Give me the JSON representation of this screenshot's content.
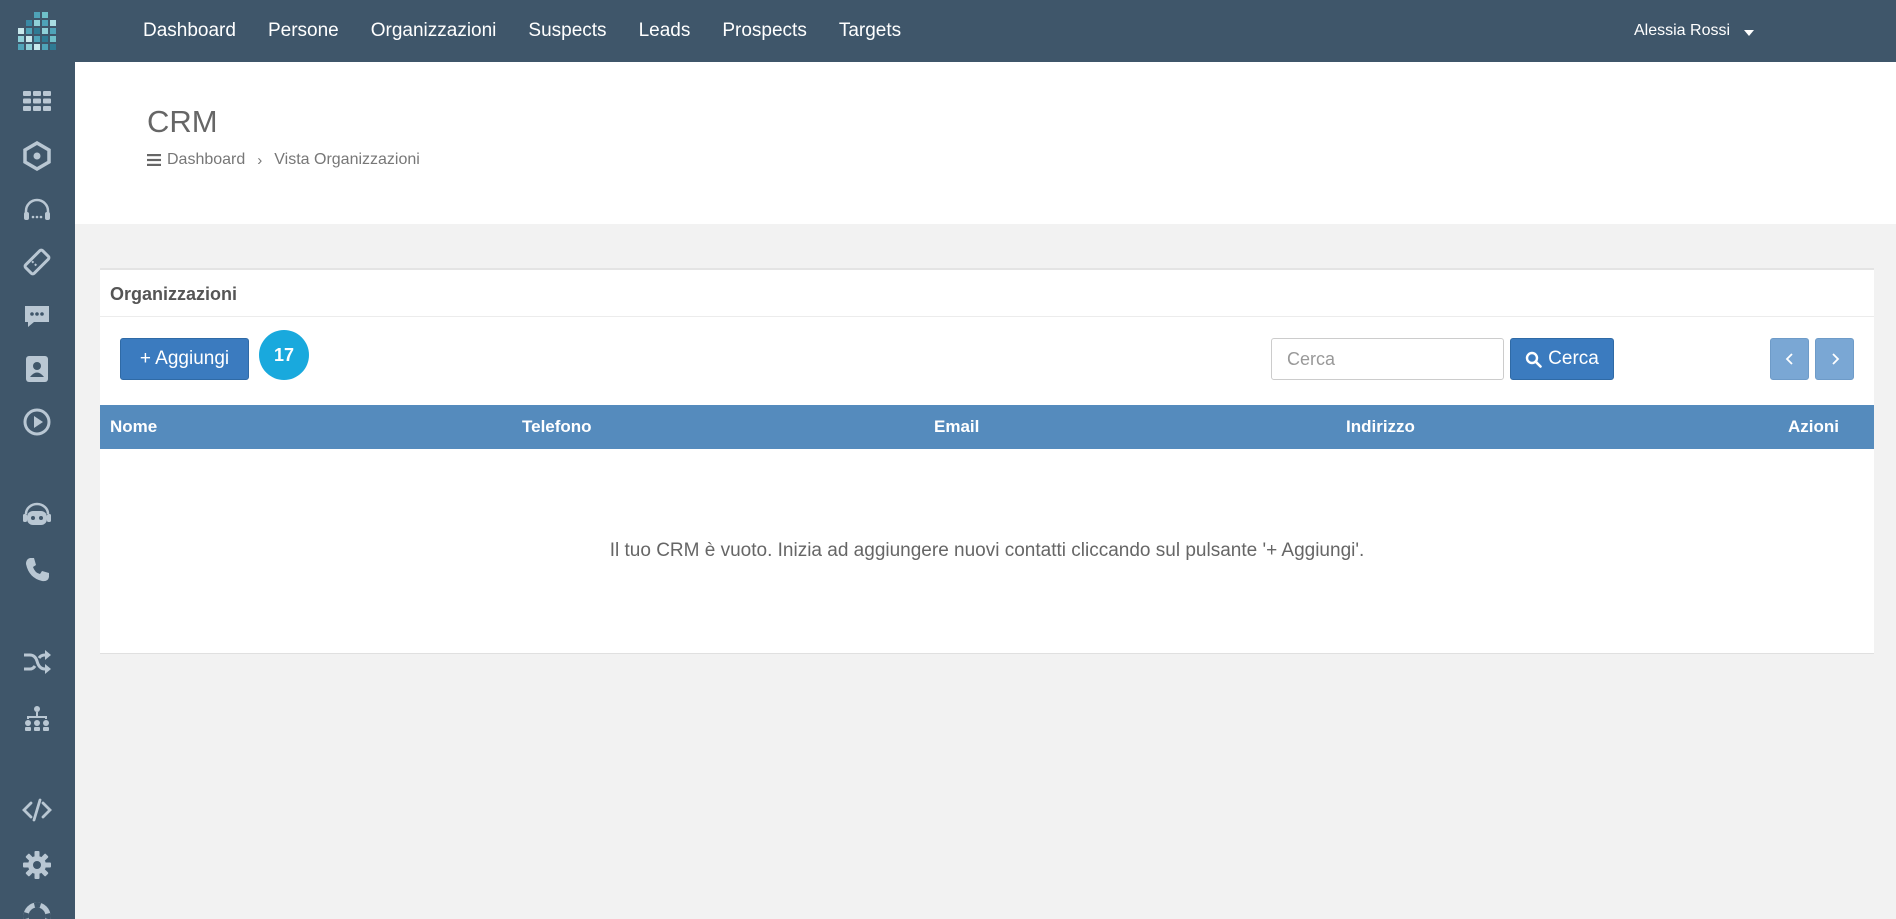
{
  "topnav": {
    "items": [
      "Dashboard",
      "Persone",
      "Organizzazioni",
      "Suspects",
      "Leads",
      "Prospects",
      "Targets"
    ],
    "user_name": "Alessia Rossi"
  },
  "sidebar": {
    "icons": [
      "grid-icon",
      "hexagon-icon",
      "headset-icon",
      "ticket-icon",
      "chat-icon",
      "contact-book-icon",
      "play-icon",
      "robot-icon",
      "phone-icon",
      "shuffle-icon",
      "org-chart-icon",
      "code-icon",
      "gear-icon",
      "lifebuoy-icon"
    ]
  },
  "header": {
    "title": "CRM",
    "breadcrumb": {
      "home": "Dashboard",
      "current": "Vista Organizzazioni"
    }
  },
  "panel": {
    "title": "Organizzazioni",
    "add_label": "+ Aggiungi",
    "badge_count": "17",
    "search_placeholder": "Cerca",
    "search_button": "Cerca",
    "columns": [
      "Nome",
      "Telefono",
      "Email",
      "Indirizzo",
      "Azioni"
    ],
    "empty_message": "Il tuo CRM è vuoto. Inizia ad aggiungere nuovi contatti cliccando sul pulsante '+ Aggiungi'."
  },
  "colors": {
    "topbar": "#3f566a",
    "primary_button": "#3b7bbf",
    "table_header": "#558bbd",
    "badge": "#19a9dd"
  }
}
